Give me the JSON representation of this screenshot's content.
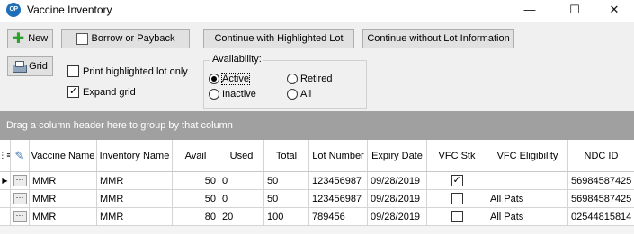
{
  "window": {
    "icon_text": "OP",
    "title": "Vaccine Inventory",
    "minimize_glyph": "—",
    "maximize_glyph": "☐",
    "close_glyph": "✕"
  },
  "toolbar": {
    "new_label": "New",
    "borrow_label": "Borrow or Payback",
    "continue_highlighted_label": "Continue with Highlighted Lot",
    "continue_without_label": "Continue without Lot Information",
    "grid_label": "Grid",
    "print_highlighted_label": "Print highlighted lot only",
    "print_highlighted_checked": false,
    "expand_grid_label": "Expand grid",
    "expand_grid_checked": true
  },
  "availability": {
    "legend": "Availability:",
    "options": [
      "Active",
      "Retired",
      "Inactive",
      "All"
    ],
    "selected": "Active"
  },
  "group_panel": {
    "hint": "Drag a column header here to group by that column"
  },
  "table": {
    "columns": [
      "Vaccine Name",
      "Inventory Name",
      "Avail",
      "Used",
      "Total",
      "Lot Number",
      "Expiry Date",
      "VFC Stk",
      "VFC Eligibility",
      "NDC ID"
    ],
    "row_indicator_glyph": "▶",
    "ellipsis_label": "···",
    "rows": [
      {
        "vaccine": "MMR",
        "inventory": "MMR",
        "avail": "50",
        "used": "0",
        "total": "50",
        "lot": "123456987",
        "expiry": "09/28/2019",
        "vfc_stk": true,
        "vfc_elig": "",
        "ndc": "56984587425",
        "current": true
      },
      {
        "vaccine": "MMR",
        "inventory": "MMR",
        "avail": "50",
        "used": "0",
        "total": "50",
        "lot": "123456987",
        "expiry": "09/28/2019",
        "vfc_stk": false,
        "vfc_elig": "All Pats",
        "ndc": "56984587425",
        "current": false
      },
      {
        "vaccine": "MMR",
        "inventory": "MMR",
        "avail": "80",
        "used": "20",
        "total": "100",
        "lot": "789456",
        "expiry": "09/28/2019",
        "vfc_stk": false,
        "vfc_elig": "All Pats",
        "ndc": "02544815814",
        "current": false
      }
    ]
  },
  "icons": {
    "new": "plus-icon",
    "borrow": "book-icon",
    "grid": "printer-icon",
    "column_chooser": "column-chooser-icon",
    "edit": "pencil-icon"
  },
  "colors": {
    "toolbar_bg": "#f0f0f0",
    "group_panel_bg": "#a0a0a0",
    "app_icon_bg": "#1d6fb8",
    "plus_green": "#2ea02e"
  }
}
